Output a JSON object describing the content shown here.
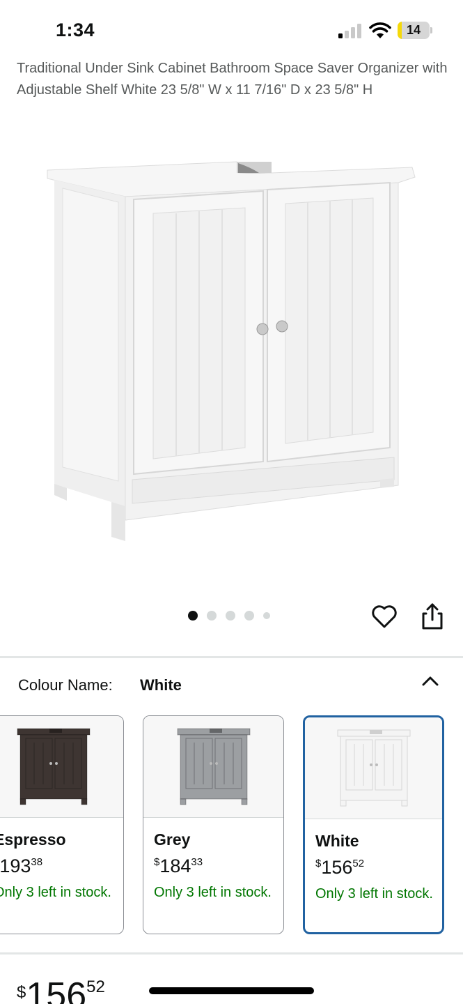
{
  "status_bar": {
    "time": "1:34",
    "battery_level": "14",
    "battery_color": "#f5d90a"
  },
  "product": {
    "title": "Traditional Under Sink Cabinet Bathroom Space Saver Organizer with Adjustable Shelf White 23 5/8\" W x 11 7/16\" D x 23 5/8\" H",
    "image_icon": "cabinet-photo",
    "carousel": {
      "total": 5,
      "active_index": 0
    }
  },
  "actions": {
    "favorite_icon": "heart-icon",
    "share_icon": "share-icon"
  },
  "colour": {
    "label": "Colour Name:",
    "selected": "White",
    "toggle_icon": "chevron-up-icon",
    "options": [
      {
        "name": "Espresso",
        "symbol": "$",
        "price_whole": "193",
        "price_fraction": "38",
        "stock": "Only 3 left in stock.",
        "swatch_color": "#3e3532",
        "selected": false
      },
      {
        "name": "Grey",
        "symbol": "$",
        "price_whole": "184",
        "price_fraction": "33",
        "stock": "Only 3 left in stock.",
        "swatch_color": "#9c9fa2",
        "selected": false
      },
      {
        "name": "White",
        "symbol": "$",
        "price_whole": "156",
        "price_fraction": "52",
        "stock": "Only 3 left in stock.",
        "swatch_color": "#f4f4f4",
        "selected": true
      }
    ]
  },
  "price": {
    "symbol": "$",
    "whole": "156",
    "fraction": "52"
  },
  "colors": {
    "accent_selected_border": "#2162a1",
    "stock_green": "#007600",
    "title_grey": "#565959"
  }
}
